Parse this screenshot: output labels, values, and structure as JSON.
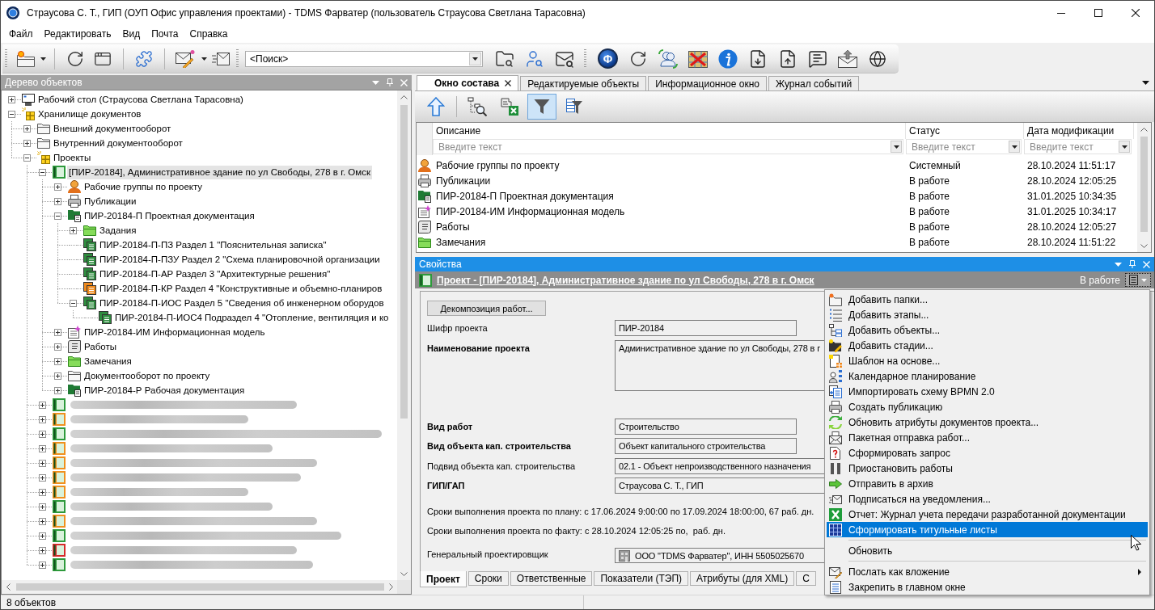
{
  "window": {
    "title": "Страусова С. Т., ГИП (ОУП Офис управления проектами) - TDMS Фарватер (пользователь Страусова Светлана Тарасовна)"
  },
  "menu_bar": [
    "Файл",
    "Редактировать",
    "Вид",
    "Почта",
    "Справка"
  ],
  "toolbar": {
    "logo": "Φ",
    "search": {
      "value": "<Поиск>"
    }
  },
  "object_tree": {
    "title": "Дерево объектов",
    "items": [
      {
        "kind": "desktop",
        "label": "Рабочий стол (Страусова Светлана Тарасовна)",
        "expanded": false,
        "selected": false
      },
      {
        "kind": "storage",
        "label": "Хранилище документов",
        "expanded": true,
        "selected": false,
        "children": [
          {
            "kind": "folder",
            "label": "Внешний документооборот",
            "expanded": false,
            "selected": false
          },
          {
            "kind": "folder",
            "label": "Внутренний документооборот",
            "expanded": false,
            "selected": false
          },
          {
            "kind": "storage",
            "label": "Проекты",
            "expanded": true,
            "selected": false,
            "children": [
              {
                "kind": "project",
                "color": "#2e9a3c",
                "label": "[ПИР-20184], Административное здание по ул Свободы, 278 в г. Омск",
                "expanded": true,
                "selected": true,
                "children": [
                  {
                    "kind": "workgroup",
                    "label": "Рабочие группы по проекту",
                    "expanded": false,
                    "selected": false
                  },
                  {
                    "kind": "publication",
                    "label": "Публикации",
                    "expanded": false,
                    "selected": false
                  },
                  {
                    "kind": "docset",
                    "label": "ПИР-20184-П Проектная документация",
                    "expanded": true,
                    "selected": false,
                    "children": [
                      {
                        "kind": "taskfolder",
                        "label": "Задания",
                        "expanded": false,
                        "selected": false
                      },
                      {
                        "kind": "section",
                        "color": "#2e8b3e",
                        "label": "ПИР-20184-П-ПЗ Раздел 1 \"Пояснительная записка\"",
                        "selected": false
                      },
                      {
                        "kind": "section",
                        "color": "#2e8b3e",
                        "label": "ПИР-20184-П-ПЗУ Раздел 2 \"Схема планировочной организации",
                        "selected": false
                      },
                      {
                        "kind": "section",
                        "color": "#2e8b3e",
                        "label": "ПИР-20184-П-АР Раздел 3 \"Архитектурные решения\"",
                        "selected": false
                      },
                      {
                        "kind": "section",
                        "color": "#ef8a1e",
                        "label": "ПИР-20184-П-КР Раздел 4 \"Конструктивные и объемно-планиров",
                        "selected": false
                      },
                      {
                        "kind": "section",
                        "color": "#2e8b3e",
                        "label": "ПИР-20184-П-ИОС Раздел 5 \"Сведения об инженерном оборудов",
                        "expanded": true,
                        "selected": false,
                        "children": [
                          {
                            "kind": "section",
                            "color": "#2e8b3e",
                            "label": "ПИР-20184-П-ИОС4 Подраздел 4 \"Отопление, вентиляция и ко",
                            "selected": false
                          }
                        ]
                      }
                    ]
                  },
                  {
                    "kind": "model",
                    "label": "ПИР-20184-ИМ Информационная модель",
                    "expanded": false,
                    "selected": false
                  },
                  {
                    "kind": "works",
                    "label": "Работы",
                    "expanded": false,
                    "selected": false
                  },
                  {
                    "kind": "taskfolder",
                    "label": "Замечания",
                    "expanded": false,
                    "selected": false
                  },
                  {
                    "kind": "folder",
                    "label": "Документооборот по проекту",
                    "expanded": false,
                    "selected": false
                  },
                  {
                    "kind": "docset",
                    "label": "ПИР-20184-Р Рабочая документация",
                    "expanded": false,
                    "selected": false
                  }
                ]
              }
            ],
            "blurred_children": [
              {
                "color": "#2e9a3c",
                "expanded": false
              },
              {
                "color": "#f0901e",
                "expanded": false
              },
              {
                "color": "#2e9a3c",
                "expanded": false
              },
              {
                "color": "#f0901e",
                "expanded": false
              },
              {
                "color": "#f0901e",
                "expanded": false
              },
              {
                "color": "#f0901e",
                "expanded": false
              },
              {
                "color": "#f0901e",
                "expanded": false
              },
              {
                "color": "#2e9a3c",
                "expanded": false
              },
              {
                "color": "#f0901e",
                "expanded": false
              },
              {
                "color": "#2e9a3c",
                "expanded": false
              },
              {
                "color": "#d62a2a",
                "expanded": false
              },
              {
                "color": "#2e9a3c",
                "expanded": false
              }
            ]
          }
        ]
      }
    ]
  },
  "tabs": [
    {
      "label": "Окно состава",
      "selected": true
    },
    {
      "label": "Редактируемые объекты",
      "selected": false
    },
    {
      "label": "Информационное окно",
      "selected": false
    },
    {
      "label": "Журнал событий",
      "selected": false
    }
  ],
  "composition": {
    "tools": [
      {
        "kind": "up",
        "pressed": false
      },
      {
        "kind": "tree",
        "pressed": false
      },
      {
        "kind": "export",
        "pressed": false
      },
      {
        "kind": "filter",
        "pressed": true
      },
      {
        "kind": "columns",
        "pressed": false
      }
    ],
    "columns": [
      {
        "label": "Описание",
        "filter": {
          "placeholder": "Введите текст"
        }
      },
      {
        "label": "Статус",
        "filter": {
          "placeholder": "Введите текст"
        }
      },
      {
        "label": "Дата модификации",
        "filter": {
          "placeholder": "Введите текст"
        }
      }
    ],
    "rows": [
      {
        "kind": "workgroup",
        "description": "Рабочие группы по проекту",
        "status": "Системный",
        "modified": "28.10.2024 11:51:17"
      },
      {
        "kind": "publication",
        "description": "Публикации",
        "status": "В работе",
        "modified": "28.10.2024 12:05:25"
      },
      {
        "kind": "docset",
        "description": "ПИР-20184-П Проектная документация",
        "status": "В работе",
        "modified": "31.01.2025 10:34:35"
      },
      {
        "kind": "model",
        "description": "ПИР-20184-ИМ Информационная модель",
        "status": "В работе",
        "modified": "31.01.2025 10:34:17"
      },
      {
        "kind": "works",
        "description": "Работы",
        "status": "В работе",
        "modified": "28.10.2024 12:05:27"
      },
      {
        "kind": "taskfolder",
        "description": "Замечания",
        "status": "В работе",
        "modified": "28.10.2024 11:51:22"
      }
    ]
  },
  "properties": {
    "title": "Свойства",
    "object": {
      "title": "Проект - [ПИР-20184], Административное здание по ул Свободы, 278 в г. Омск",
      "status": "В работе",
      "menu_open": true
    },
    "action_button": "Декомпозиция работ...",
    "rows": [
      {
        "kind": "field",
        "label": "Шифр проекта",
        "required": false,
        "value": "ПИР-20184"
      },
      {
        "kind": "text",
        "label": "Наименование проекта",
        "required": true,
        "value": "Административное здание по ул Свободы, 278 в г"
      },
      {
        "kind": "field",
        "label": "Вид работ",
        "required": true,
        "value": "Строительство"
      },
      {
        "kind": "field",
        "label": "Вид объекта кап. строительства",
        "required": true,
        "value": "Объект капитального строительства"
      },
      {
        "kind": "wide",
        "label": "Подвид объекта кап. строительства",
        "required": false,
        "value": "02.1 - Объект непроизводственного назначения"
      },
      {
        "kind": "wide",
        "label": "ГИП/ГАП",
        "required": true,
        "value": "Страусова С. Т., ГИП"
      },
      {
        "kind": "note",
        "text": "Сроки выполнения проекта по плану: с 17.06.2024 9:00:00 по 17.09.2024 18:00:00, 67 раб. дн."
      },
      {
        "kind": "note",
        "text": "Сроки выполнения проекта по факту: с 28.10.2024 12:05:25 по,  раб. дн."
      },
      {
        "kind": "reference",
        "label": "Генеральный проектировщик",
        "required": false,
        "value": "ООО \"TDMS Фарватер\", ИНН 5505025670"
      }
    ],
    "tabs": [
      {
        "label": "Проект",
        "selected": true
      },
      {
        "label": "Сроки",
        "selected": false
      },
      {
        "label": "Ответственные",
        "selected": false
      },
      {
        "label": "Показатели (ТЭП)",
        "selected": false
      },
      {
        "label": "Атрибуты (для XML)",
        "selected": false
      },
      {
        "label": "С",
        "selected": false
      }
    ]
  },
  "context_menu": {
    "sections": [
      [
        {
          "label": "Добавить папки...",
          "selected": false,
          "submenu": false
        },
        {
          "label": "Добавить этапы...",
          "selected": false,
          "submenu": false
        },
        {
          "label": "Добавить объекты...",
          "selected": false,
          "submenu": false
        },
        {
          "label": "Добавить стадии...",
          "selected": false,
          "submenu": false
        },
        {
          "label": "Шаблон на основе...",
          "selected": false,
          "submenu": false
        },
        {
          "label": "Календарное планирование",
          "selected": false,
          "submenu": false
        },
        {
          "label": "Импортировать схему BPMN 2.0",
          "selected": false,
          "submenu": false
        },
        {
          "label": "Создать публикацию",
          "selected": false,
          "submenu": false
        },
        {
          "label": "Обновить атрибуты документов проекта...",
          "selected": false,
          "submenu": false
        },
        {
          "label": "Пакетная отправка работ...",
          "selected": false,
          "submenu": false
        },
        {
          "label": "Сформировать запрос",
          "selected": false,
          "submenu": false
        },
        {
          "label": "Приостановить работы",
          "selected": false,
          "submenu": false
        },
        {
          "label": "Отправить в архив",
          "selected": false,
          "submenu": false
        },
        {
          "label": "Подписаться на уведомления...",
          "selected": false,
          "submenu": false
        },
        {
          "label": "Отчет: Журнал учета передачи разработанной документации",
          "selected": false,
          "submenu": false
        },
        {
          "label": "Сформировать титульные листы",
          "selected": true,
          "submenu": false
        }
      ],
      [
        {
          "label": "Обновить",
          "selected": false,
          "submenu": false
        }
      ],
      [
        {
          "label": "Послать как вложение",
          "selected": false,
          "submenu": true
        },
        {
          "label": "Закрепить в главном окне",
          "selected": false,
          "submenu": false
        }
      ]
    ]
  },
  "status_bar": {
    "text": "8 объектов"
  }
}
